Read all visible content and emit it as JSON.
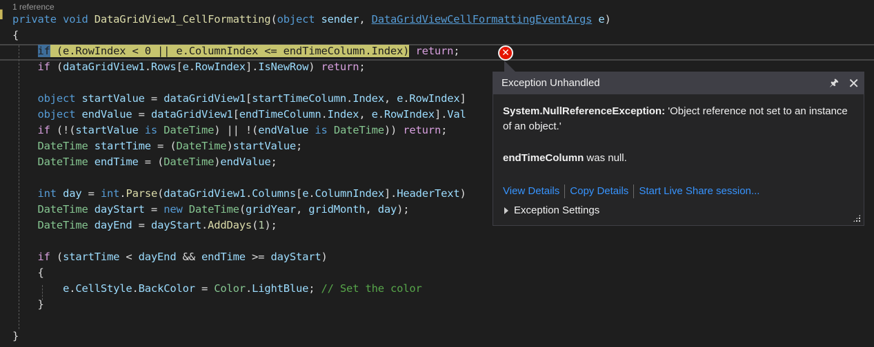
{
  "editor": {
    "codelens": "1 reference",
    "lines": [
      {
        "tokens": [
          [
            "kw",
            "private"
          ],
          [
            "plain",
            " "
          ],
          [
            "kw",
            "void"
          ],
          [
            "plain",
            " "
          ],
          [
            "m",
            "DataGridView1_CellFormatting"
          ],
          [
            "plain",
            "("
          ],
          [
            "kw",
            "object"
          ],
          [
            "plain",
            " "
          ],
          [
            "id",
            "sender"
          ],
          [
            "plain",
            ", "
          ],
          [
            "link",
            "DataGridViewCellFormattingEventArgs"
          ],
          [
            "plain",
            " "
          ],
          [
            "id",
            "e"
          ],
          [
            "plain",
            ")"
          ]
        ]
      },
      {
        "tokens": [
          [
            "plain",
            "{"
          ]
        ]
      },
      {
        "tokens": [
          [
            "plain",
            "    "
          ],
          [
            "hlsel",
            "if"
          ],
          [
            "hl",
            " (e.RowIndex < 0 || e.ColumnIndex <= endTimeColumn.Index)"
          ],
          [
            "plain",
            " "
          ],
          [
            "ctl",
            "return"
          ],
          [
            "plain",
            ";"
          ]
        ]
      },
      {
        "tokens": [
          [
            "plain",
            "    "
          ],
          [
            "ctl",
            "if"
          ],
          [
            "plain",
            " ("
          ],
          [
            "id",
            "dataGridView1"
          ],
          [
            "plain",
            "."
          ],
          [
            "id",
            "Rows"
          ],
          [
            "plain",
            "["
          ],
          [
            "id",
            "e"
          ],
          [
            "plain",
            "."
          ],
          [
            "id",
            "RowIndex"
          ],
          [
            "plain",
            "]."
          ],
          [
            "id",
            "IsNewRow"
          ],
          [
            "plain",
            ") "
          ],
          [
            "ctl",
            "return"
          ],
          [
            "plain",
            ";"
          ]
        ]
      },
      {
        "tokens": []
      },
      {
        "tokens": [
          [
            "plain",
            "    "
          ],
          [
            "kw",
            "object"
          ],
          [
            "plain",
            " "
          ],
          [
            "id",
            "startValue"
          ],
          [
            "plain",
            " = "
          ],
          [
            "id",
            "dataGridView1"
          ],
          [
            "plain",
            "["
          ],
          [
            "id",
            "startTimeColumn"
          ],
          [
            "plain",
            "."
          ],
          [
            "id",
            "Index"
          ],
          [
            "plain",
            ", "
          ],
          [
            "id",
            "e"
          ],
          [
            "plain",
            "."
          ],
          [
            "id",
            "RowIndex"
          ],
          [
            "plain",
            "]"
          ]
        ]
      },
      {
        "tokens": [
          [
            "plain",
            "    "
          ],
          [
            "kw",
            "object"
          ],
          [
            "plain",
            " "
          ],
          [
            "id",
            "endValue"
          ],
          [
            "plain",
            " = "
          ],
          [
            "id",
            "dataGridView1"
          ],
          [
            "plain",
            "["
          ],
          [
            "id",
            "endTimeColumn"
          ],
          [
            "plain",
            "."
          ],
          [
            "id",
            "Index"
          ],
          [
            "plain",
            ", "
          ],
          [
            "id",
            "e"
          ],
          [
            "plain",
            "."
          ],
          [
            "id",
            "RowIndex"
          ],
          [
            "plain",
            "]."
          ],
          [
            "id",
            "Val"
          ]
        ]
      },
      {
        "tokens": [
          [
            "plain",
            "    "
          ],
          [
            "ctl",
            "if"
          ],
          [
            "plain",
            " (!("
          ],
          [
            "id",
            "startValue"
          ],
          [
            "plain",
            " "
          ],
          [
            "kw",
            "is"
          ],
          [
            "plain",
            " "
          ],
          [
            "ty2",
            "DateTime"
          ],
          [
            "plain",
            ") || !("
          ],
          [
            "id",
            "endValue"
          ],
          [
            "plain",
            " "
          ],
          [
            "kw",
            "is"
          ],
          [
            "plain",
            " "
          ],
          [
            "ty2",
            "DateTime"
          ],
          [
            "plain",
            ")) "
          ],
          [
            "ctl",
            "return"
          ],
          [
            "plain",
            ";"
          ]
        ]
      },
      {
        "tokens": [
          [
            "plain",
            "    "
          ],
          [
            "ty2",
            "DateTime"
          ],
          [
            "plain",
            " "
          ],
          [
            "id",
            "startTime"
          ],
          [
            "plain",
            " = ("
          ],
          [
            "ty2",
            "DateTime"
          ],
          [
            "plain",
            ")"
          ],
          [
            "id",
            "startValue"
          ],
          [
            "plain",
            ";"
          ]
        ]
      },
      {
        "tokens": [
          [
            "plain",
            "    "
          ],
          [
            "ty2",
            "DateTime"
          ],
          [
            "plain",
            " "
          ],
          [
            "id",
            "endTime"
          ],
          [
            "plain",
            " = ("
          ],
          [
            "ty2",
            "DateTime"
          ],
          [
            "plain",
            ")"
          ],
          [
            "id",
            "endValue"
          ],
          [
            "plain",
            ";"
          ]
        ]
      },
      {
        "tokens": []
      },
      {
        "tokens": [
          [
            "plain",
            "    "
          ],
          [
            "kw",
            "int"
          ],
          [
            "plain",
            " "
          ],
          [
            "id",
            "day"
          ],
          [
            "plain",
            " = "
          ],
          [
            "kw",
            "int"
          ],
          [
            "plain",
            "."
          ],
          [
            "m",
            "Parse"
          ],
          [
            "plain",
            "("
          ],
          [
            "id",
            "dataGridView1"
          ],
          [
            "plain",
            "."
          ],
          [
            "id",
            "Columns"
          ],
          [
            "plain",
            "["
          ],
          [
            "id",
            "e"
          ],
          [
            "plain",
            "."
          ],
          [
            "id",
            "ColumnIndex"
          ],
          [
            "plain",
            "]."
          ],
          [
            "id",
            "HeaderText"
          ],
          [
            "plain",
            ")"
          ]
        ]
      },
      {
        "tokens": [
          [
            "plain",
            "    "
          ],
          [
            "ty2",
            "DateTime"
          ],
          [
            "plain",
            " "
          ],
          [
            "id",
            "dayStart"
          ],
          [
            "plain",
            " = "
          ],
          [
            "kw",
            "new"
          ],
          [
            "plain",
            " "
          ],
          [
            "ty2",
            "DateTime"
          ],
          [
            "plain",
            "("
          ],
          [
            "id",
            "gridYear"
          ],
          [
            "plain",
            ", "
          ],
          [
            "id",
            "gridMonth"
          ],
          [
            "plain",
            ", "
          ],
          [
            "id",
            "day"
          ],
          [
            "plain",
            ");"
          ]
        ]
      },
      {
        "tokens": [
          [
            "plain",
            "    "
          ],
          [
            "ty2",
            "DateTime"
          ],
          [
            "plain",
            " "
          ],
          [
            "id",
            "dayEnd"
          ],
          [
            "plain",
            " = "
          ],
          [
            "id",
            "dayStart"
          ],
          [
            "plain",
            "."
          ],
          [
            "m",
            "AddDays"
          ],
          [
            "plain",
            "("
          ],
          [
            "num",
            "1"
          ],
          [
            "plain",
            ");"
          ]
        ]
      },
      {
        "tokens": []
      },
      {
        "tokens": [
          [
            "plain",
            "    "
          ],
          [
            "ctl",
            "if"
          ],
          [
            "plain",
            " ("
          ],
          [
            "id",
            "startTime"
          ],
          [
            "plain",
            " < "
          ],
          [
            "id",
            "dayEnd"
          ],
          [
            "plain",
            " && "
          ],
          [
            "id",
            "endTime"
          ],
          [
            "plain",
            " >= "
          ],
          [
            "id",
            "dayStart"
          ],
          [
            "plain",
            ")"
          ]
        ]
      },
      {
        "tokens": [
          [
            "plain",
            "    {"
          ]
        ]
      },
      {
        "tokens": [
          [
            "plain",
            "        "
          ],
          [
            "id",
            "e"
          ],
          [
            "plain",
            "."
          ],
          [
            "id",
            "CellStyle"
          ],
          [
            "plain",
            "."
          ],
          [
            "id",
            "BackColor"
          ],
          [
            "plain",
            " = "
          ],
          [
            "ty2",
            "Color"
          ],
          [
            "plain",
            "."
          ],
          [
            "id",
            "LightBlue"
          ],
          [
            "plain",
            "; "
          ],
          [
            "cm",
            "// Set the color"
          ]
        ]
      },
      {
        "tokens": [
          [
            "plain",
            "    }"
          ]
        ]
      },
      {
        "tokens": []
      },
      {
        "tokens": [
          [
            "plain",
            "}"
          ]
        ]
      }
    ]
  },
  "exception_popup": {
    "title": "Exception Unhandled",
    "pin_icon": "pin-icon",
    "close_icon": "close-icon",
    "exception_type": "System.NullReferenceException:",
    "exception_message": " 'Object reference not set to an instance of an object.'",
    "null_variable": "endTimeColumn",
    "null_suffix": " was null.",
    "links": [
      "View Details",
      "Copy Details",
      "Start Live Share session..."
    ],
    "settings_label": "Exception Settings"
  },
  "colors": {
    "background": "#1e1e1e",
    "current_statement_highlight": "#c6c46e",
    "error_icon": "#e51400",
    "link": "#3794ff"
  }
}
